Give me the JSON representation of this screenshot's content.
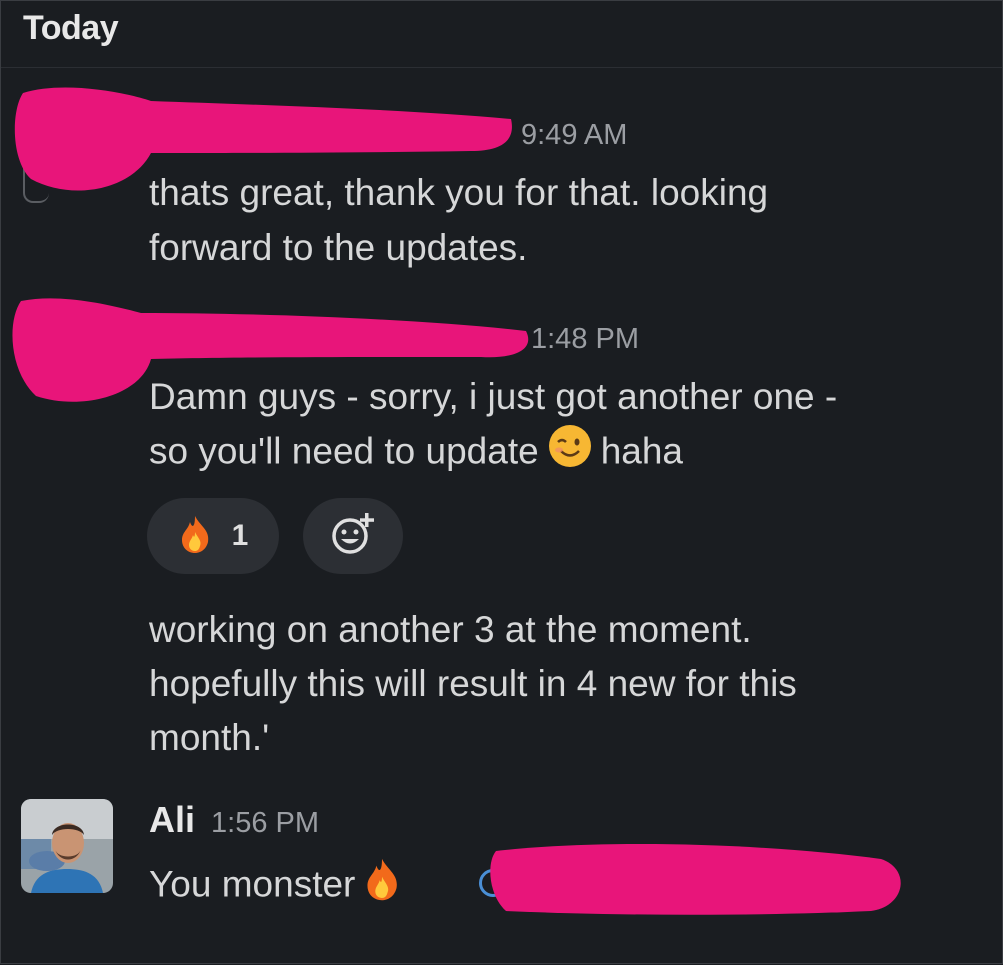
{
  "header": {
    "day": "Today"
  },
  "messages": [
    {
      "time": "9:49 AM",
      "lines": [
        "thats great, thank you for that. looking",
        "forward to the updates."
      ],
      "redacted_author": true
    },
    {
      "time": "1:48 PM",
      "lines": [
        "Damn guys - sorry, i just got another one -",
        "so you'll need to update",
        "haha"
      ],
      "inline_emoji": "winking-face-emoji",
      "redacted_author": true,
      "reactions": [
        {
          "emoji": "fire-emoji",
          "count": "1"
        }
      ],
      "add_reaction_icon": "add-reaction-icon",
      "followup_lines": [
        "working on another 3 at the moment.",
        "hopefully this will result in 4 new for this",
        "month.'"
      ]
    },
    {
      "author": "Ali",
      "time": "1:56 PM",
      "text": "You monster",
      "inline_emoji": "fire-emoji",
      "mention_redacted": true
    }
  ],
  "colors": {
    "background": "#1a1d21",
    "text": "#d6d7d8",
    "timestamp": "#9b9ea3",
    "redaction": "#e8157a",
    "pill": "#2c2f34"
  }
}
